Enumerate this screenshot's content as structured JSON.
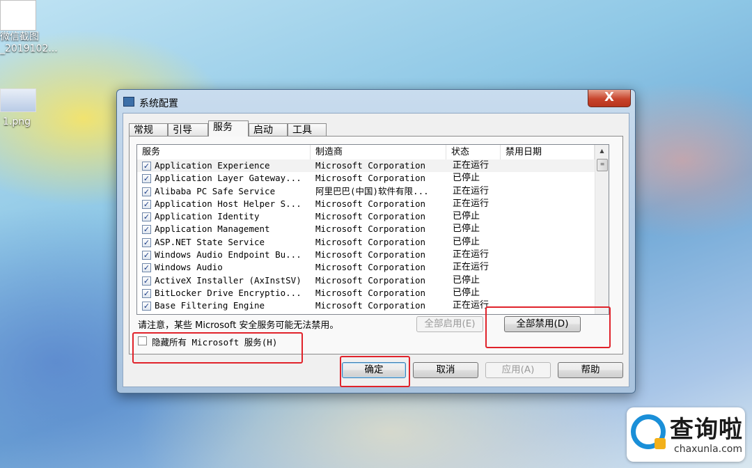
{
  "desktop": {
    "icon1_line1": "微信截图",
    "icon1_line2": "_2019102...",
    "icon2_label": "1.png"
  },
  "dialog": {
    "title": "系统配置",
    "close_glyph": "X",
    "tabs": [
      {
        "label": "常规"
      },
      {
        "label": "引导"
      },
      {
        "label": "服务"
      },
      {
        "label": "启动"
      },
      {
        "label": "工具"
      }
    ],
    "active_tab": "服务",
    "columns": [
      "服务",
      "制造商",
      "状态",
      "禁用日期"
    ],
    "services": [
      {
        "name": "Application Experience",
        "vendor": "Microsoft Corporation",
        "status": "正在运行",
        "checked": true
      },
      {
        "name": "Application Layer Gateway...",
        "vendor": "Microsoft Corporation",
        "status": "已停止",
        "checked": true
      },
      {
        "name": "Alibaba PC Safe Service",
        "vendor": "阿里巴巴(中国)软件有限...",
        "status": "正在运行",
        "checked": true
      },
      {
        "name": "Application Host Helper S...",
        "vendor": "Microsoft Corporation",
        "status": "正在运行",
        "checked": true
      },
      {
        "name": "Application Identity",
        "vendor": "Microsoft Corporation",
        "status": "已停止",
        "checked": true
      },
      {
        "name": "Application Management",
        "vendor": "Microsoft Corporation",
        "status": "已停止",
        "checked": true
      },
      {
        "name": "ASP.NET State Service",
        "vendor": "Microsoft Corporation",
        "status": "已停止",
        "checked": true
      },
      {
        "name": "Windows Audio Endpoint Bu...",
        "vendor": "Microsoft Corporation",
        "status": "正在运行",
        "checked": true
      },
      {
        "name": "Windows Audio",
        "vendor": "Microsoft Corporation",
        "status": "正在运行",
        "checked": true
      },
      {
        "name": "ActiveX Installer (AxInstSV)",
        "vendor": "Microsoft Corporation",
        "status": "已停止",
        "checked": true
      },
      {
        "name": "BitLocker Drive Encryptio...",
        "vendor": "Microsoft Corporation",
        "status": "已停止",
        "checked": true
      },
      {
        "name": "Base Filtering Engine",
        "vendor": "Microsoft Corporation",
        "status": "正在运行",
        "checked": true
      }
    ],
    "note": "请注意，某些 Microsoft 安全服务可能无法禁用。",
    "enable_all": "全部启用(E)",
    "disable_all": "全部禁用(D)",
    "hide_ms_label": "隐藏所有 Microsoft 服务(H)",
    "hide_ms_checked": false,
    "ok": "确定",
    "cancel": "取消",
    "apply": "应用(A)",
    "help": "帮助"
  },
  "watermark": {
    "text": "查询啦",
    "sub": "chaxunla.com"
  }
}
